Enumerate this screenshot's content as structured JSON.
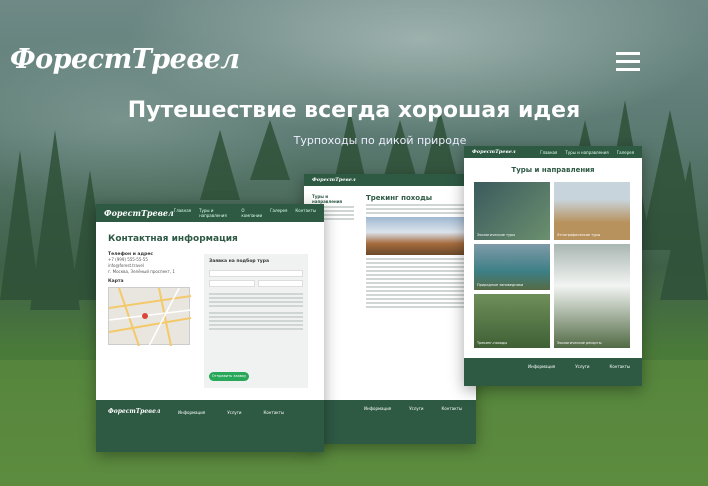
{
  "brand": {
    "logo": "ФорестТревел"
  },
  "hero": {
    "title": "Путешествие всегда хорошая идея",
    "subtitle": "Турпоходы по дикой природе"
  },
  "contact_card": {
    "logo": "ФорестТревел",
    "nav": [
      "Главная",
      "Туры и направления",
      "О компании",
      "Галерея",
      "Контакты"
    ],
    "heading": "Контактная информация",
    "phone_label": "Телефон и адрес",
    "phone": "+7 (999) 555-55-55",
    "email": "info@forest.travel",
    "address": "г. Москва, Зелёный проспект, 1",
    "map_label": "Карта",
    "form_title": "Заявка на подбор тура",
    "button": "Отправить заявку",
    "footer_cols": [
      "Информация",
      "Услуги",
      "Контакты"
    ]
  },
  "trek_card": {
    "logo": "ФорестТревел",
    "heading": "Трекинг походы",
    "side_title": "Туры и направления",
    "footer_cols": [
      "Информация",
      "Услуги",
      "Контакты"
    ]
  },
  "tours_card": {
    "logo": "ФорестТревел",
    "nav": [
      "Главная",
      "Туры и направления",
      "О компании",
      "Галерея",
      "Контакты"
    ],
    "heading": "Туры и направления",
    "tiles": [
      "Экологические туры",
      "Этнографические туры",
      "Экотуры",
      "Природные заповедники",
      "Трекинг-походы",
      "Экологические ресорты"
    ],
    "footer_cols": [
      "Информация",
      "Услуги",
      "Контакты"
    ]
  }
}
